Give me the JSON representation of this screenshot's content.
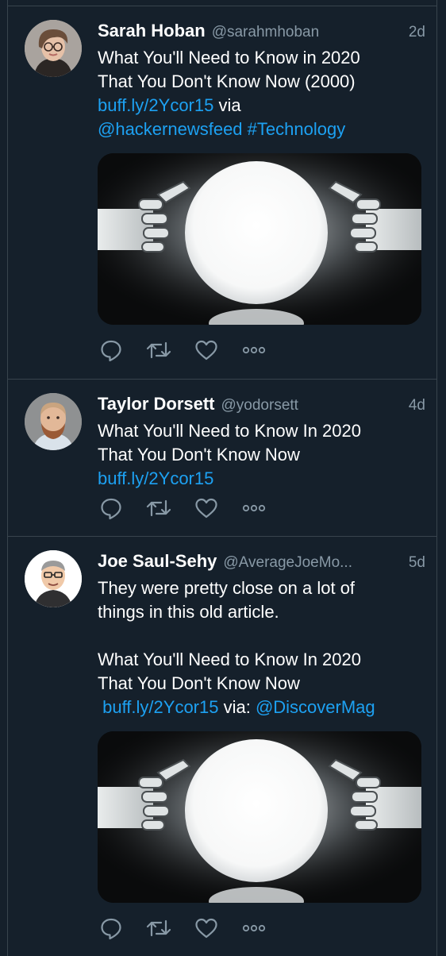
{
  "tweets": [
    {
      "name": "Sarah Hoban",
      "handle": "@sarahmhoban",
      "time": "2d",
      "lines": [
        [
          {
            "text": "What You'll Need to Know in 2020"
          }
        ],
        [
          {
            "text": "That You Don't Know Now (2000)"
          }
        ],
        [
          {
            "text": "buff.ly/2Ycor15",
            "link": true
          },
          {
            "text": " via"
          }
        ],
        [
          {
            "text": "@hackernewsfeed",
            "link": true
          },
          {
            "text": " "
          },
          {
            "text": "#Technology",
            "link": true
          }
        ]
      ],
      "media_icon": "crystal-ball-robot-hands-image"
    },
    {
      "name": "Taylor Dorsett",
      "handle": "@yodorsett",
      "time": "4d",
      "lines": [
        [
          {
            "text": "What You'll Need to Know In 2020"
          }
        ],
        [
          {
            "text": "That You Don't Know Now"
          }
        ],
        [
          {
            "text": "buff.ly/2Ycor15",
            "link": true
          }
        ]
      ]
    },
    {
      "name": "Joe Saul-Sehy",
      "handle": "@AverageJoeMo...",
      "time": "5d",
      "lines": [
        [
          {
            "text": "They were pretty close on a lot of"
          }
        ],
        [
          {
            "text": "things in this old article."
          }
        ],
        [
          {
            "text": ""
          }
        ],
        [
          {
            "text": "What You'll Need to Know In 2020"
          }
        ],
        [
          {
            "text": "That You Don't Know Now"
          }
        ],
        [
          {
            "text": " "
          },
          {
            "text": "buff.ly/2Ycor15",
            "link": true
          },
          {
            "text": " via: "
          },
          {
            "text": "@DiscoverMag",
            "link": true
          }
        ]
      ],
      "media_icon": "crystal-ball-robot-hands-image"
    }
  ],
  "actions": [
    {
      "name": "reply",
      "icon": "reply-icon"
    },
    {
      "name": "retweet",
      "icon": "retweet-icon"
    },
    {
      "name": "like",
      "icon": "heart-icon"
    },
    {
      "name": "more",
      "icon": "more-icon"
    }
  ],
  "colors": {
    "background": "#15202b",
    "border": "#38444d",
    "link": "#1da1f2",
    "secondary_text": "#8899a6",
    "icon": "#8899a6"
  }
}
